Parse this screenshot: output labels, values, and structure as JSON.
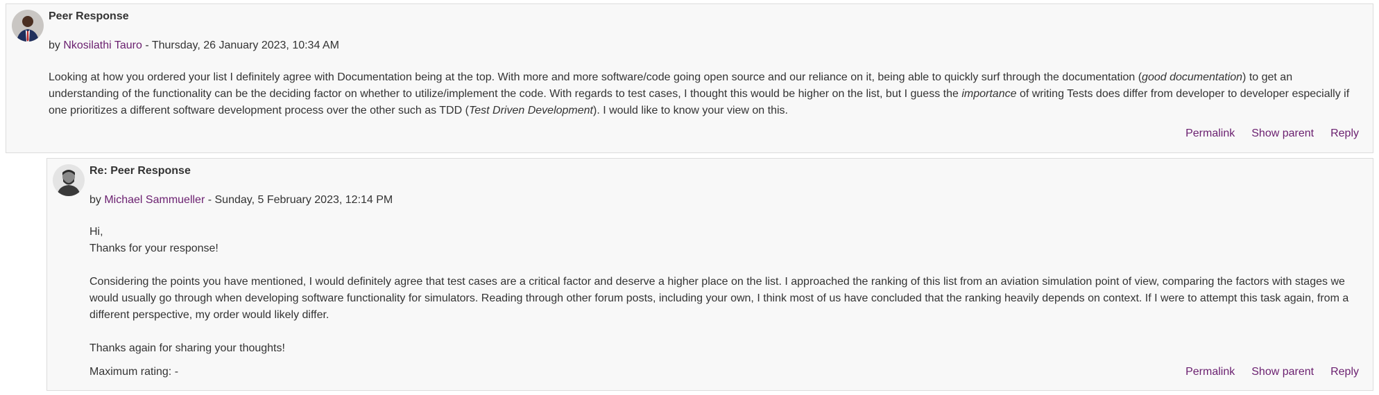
{
  "posts": [
    {
      "subject": "Peer Response",
      "by": "by ",
      "author": "Nkosilathi Tauro",
      "date": " - Thursday, 26 January 2023, 10:34 AM",
      "body": {
        "p1_a": "Looking at how you ordered your list I definitely agree with Documentation being at the top. With more and more software/code going open source and our reliance on it, being able to quickly surf through the documentation (",
        "p1_em1": "good documentation",
        "p1_b": ") to get an understanding of the functionality can be the deciding factor on whether to utilize/implement the code. With regards to test cases, I thought this would be higher on the list, but I guess the ",
        "p1_em2": "importance",
        "p1_c": " of writing Tests does differ from developer to developer especially if one prioritizes a different software development process over the other such as TDD (",
        "p1_em3": "Test Driven Development",
        "p1_d": "). I would like to know your view on this."
      },
      "actions": {
        "permalink": "Permalink",
        "show_parent": "Show parent",
        "reply": "Reply"
      }
    },
    {
      "subject": "Re: Peer Response",
      "by": "by ",
      "author": "Michael Sammueller",
      "date": " - Sunday, 5 February 2023, 12:14 PM",
      "body": {
        "greeting": "Hi,",
        "thanks": "Thanks for your response!",
        "paragraph": "Considering the points you have mentioned, I would definitely agree that test cases are a critical factor and deserve a higher place on the list. I approached the ranking of this list from an aviation simulation point of view, comparing the factors with stages we would usually go through when developing software functionality for simulators. Reading through other forum posts, including your own, I think most of us have concluded that the ranking heavily depends on context. If I were to attempt this task again, from a different perspective, my order would likely differ.",
        "closing": "Thanks again for sharing your thoughts!"
      },
      "rating": "Maximum rating: -",
      "actions": {
        "permalink": "Permalink",
        "show_parent": "Show parent",
        "reply": "Reply"
      }
    }
  ],
  "colors": {
    "link": "#6a1f6f",
    "text": "#333333",
    "post_bg": "#f8f8f8",
    "border": "#dcdcdc"
  }
}
